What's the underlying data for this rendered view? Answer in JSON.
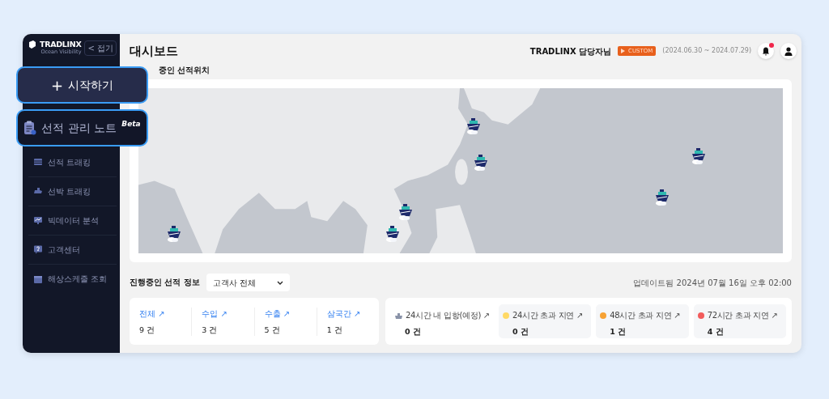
{
  "sidebar": {
    "logo": "TRADLINX",
    "tagline": "Ocean Visibility",
    "collapse_button": "< 접기",
    "items": [
      {
        "kind": "shipment",
        "label": "선적 트래킹"
      },
      {
        "kind": "vessel",
        "label": "선박 트래킹"
      },
      {
        "kind": "analytics",
        "label": "빅데이터 분석"
      },
      {
        "kind": "support",
        "label": "고객센터"
      },
      {
        "kind": "schedule",
        "label": "해상스케줄 조회"
      }
    ]
  },
  "callouts": [
    {
      "kind": "start",
      "icon": "+",
      "label": "시작하기"
    },
    {
      "kind": "note",
      "label": "선적 관리 노트",
      "badge": "Beta"
    }
  ],
  "header": {
    "title": "대시보드",
    "user": "TRADLINX 담당자님",
    "plan": "CUSTOM",
    "period": "(2024.06.30 ~ 2024.07.29)",
    "notification": true
  },
  "map_section": {
    "title": "중인 선적위치"
  },
  "shipments": {
    "title": "진행중인 선적 정보",
    "filter": "고객사 전체",
    "updated": "업데이트됨 2024년 07월 16일 오후 02:00",
    "totals": [
      {
        "label": "전체 ↗",
        "count": "9 건"
      },
      {
        "label": "수입 ↗",
        "count": "3 건"
      },
      {
        "label": "수출 ↗",
        "count": "5 건"
      },
      {
        "label": "삼국간 ↗",
        "count": "1 건"
      }
    ],
    "arrivals": [
      {
        "kind": "arrival",
        "label": "24시간 내 입항(예정) ↗",
        "count": "0 건"
      },
      {
        "kind": "delay",
        "color": "#ffd966",
        "label": "24시간 초과 지연 ↗",
        "count": "0 건"
      },
      {
        "kind": "delay",
        "color": "#f7a234",
        "label": "48시간 초과 지연 ↗",
        "count": "1 건"
      },
      {
        "kind": "delay",
        "color": "#f25c5c",
        "label": "72시간 초과 지연 ↗",
        "count": "4 건"
      }
    ]
  }
}
